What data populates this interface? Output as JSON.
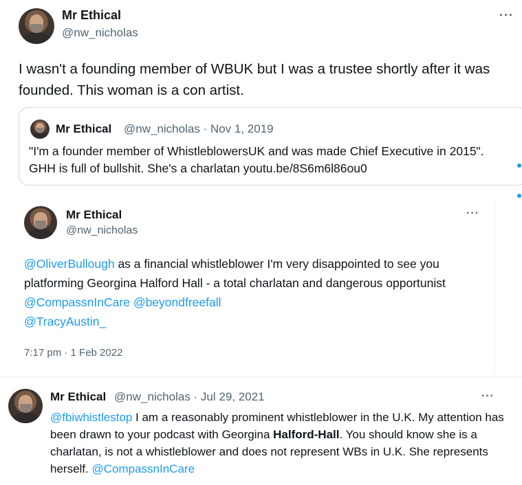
{
  "tweet1": {
    "name": "Mr Ethical",
    "handle": "@nw_nicholas",
    "more": "···",
    "text": "I wasn't a founding member of WBUK but I was a trustee shortly after it was founded. This woman is a con artist.",
    "quote": {
      "name": "Mr Ethical",
      "handle_date": "@nw_nicholas · Nov 1, 2019",
      "text_before": "\"I'm a founder member of WhistleblowersUK and was made Chief Executive in 2015\". GHH is full of bullshit. She's a charlatan ",
      "link": "youtu.be/8S6m6l86ou0"
    }
  },
  "tweet2": {
    "name": "Mr Ethical",
    "handle": "@nw_nicholas",
    "more": "···",
    "mention1": "@OliverBullough",
    "text1": " as a financial whistleblower I'm very disappointed to see you platforming Georgina Halford Hall - a total charlatan and dangerous opportunist ",
    "mention2": "@CompassnInCare",
    "mention3": "@beyondfreefall",
    "mention4": "@TracyAustin_",
    "timestamp": "7:17 pm · 1 Feb 2022"
  },
  "tweet3": {
    "name": "Mr Ethical",
    "handle_date": "@nw_nicholas · Jul 29, 2021",
    "more": "···",
    "mention1": "@fbiwhistlestop",
    "text1": " I am a reasonably prominent whistleblower in the U.K.  My attention has been drawn to your podcast with Georgina ",
    "bold": "Halford-Hall",
    "text2": ". You should know she is a charlatan, is not a whistleblower and does not represent WBs in U.K.  She represents herself. ",
    "mention2": "@CompassnInCare"
  },
  "colors": {
    "link": "#1d9bf0",
    "muted": "#536471",
    "text": "#0f1419",
    "border": "#cfd9de"
  }
}
